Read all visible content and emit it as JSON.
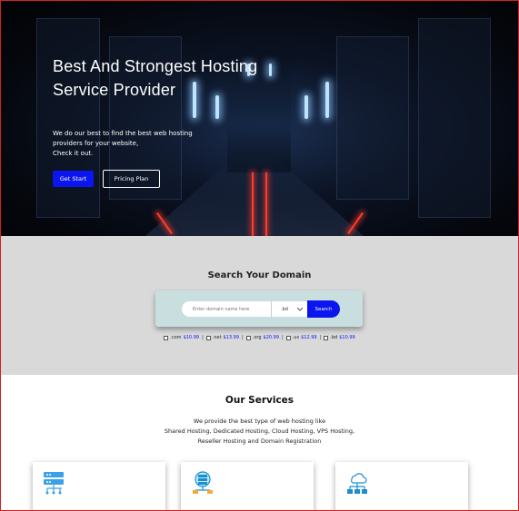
{
  "hero": {
    "title": "Best And Strongest Hosting Service Provider",
    "subtitle_line1": "We do our best to find the best web hosting",
    "subtitle_line2": "providers for your website,",
    "subtitle_line3": "Check it out.",
    "start_label": "Get Start",
    "plan_label": "Pricing Plan"
  },
  "domain": {
    "title": "Search Your Domain",
    "input_placeholder": "Enter domain name here",
    "select_value": ".bd",
    "search_label": "Search",
    "tlds": [
      {
        "ext": ".com",
        "price": "$10.99"
      },
      {
        "ext": ".net",
        "price": "$13.99"
      },
      {
        "ext": ".org",
        "price": "$20.99"
      },
      {
        "ext": ".us",
        "price": "$12.99"
      },
      {
        "ext": ".bd",
        "price": "$10.99"
      }
    ]
  },
  "services": {
    "title": "Our Services",
    "desc_line1": "We provide the best type of web hosting like",
    "desc_line2": "Shared Hosting, Dedicated Hosting, Cloud Hosting, VPS Hosting,",
    "desc_line3": "Reseller Hosting and Domain Registration",
    "cards": [
      {
        "icon": "server-rack-icon"
      },
      {
        "icon": "dedicated-server-icon"
      },
      {
        "icon": "cloud-network-icon"
      }
    ]
  },
  "colors": {
    "accent": "#0a15f0",
    "domain_bg": "#d9d9d9",
    "search_box_bg": "#c9dede"
  }
}
